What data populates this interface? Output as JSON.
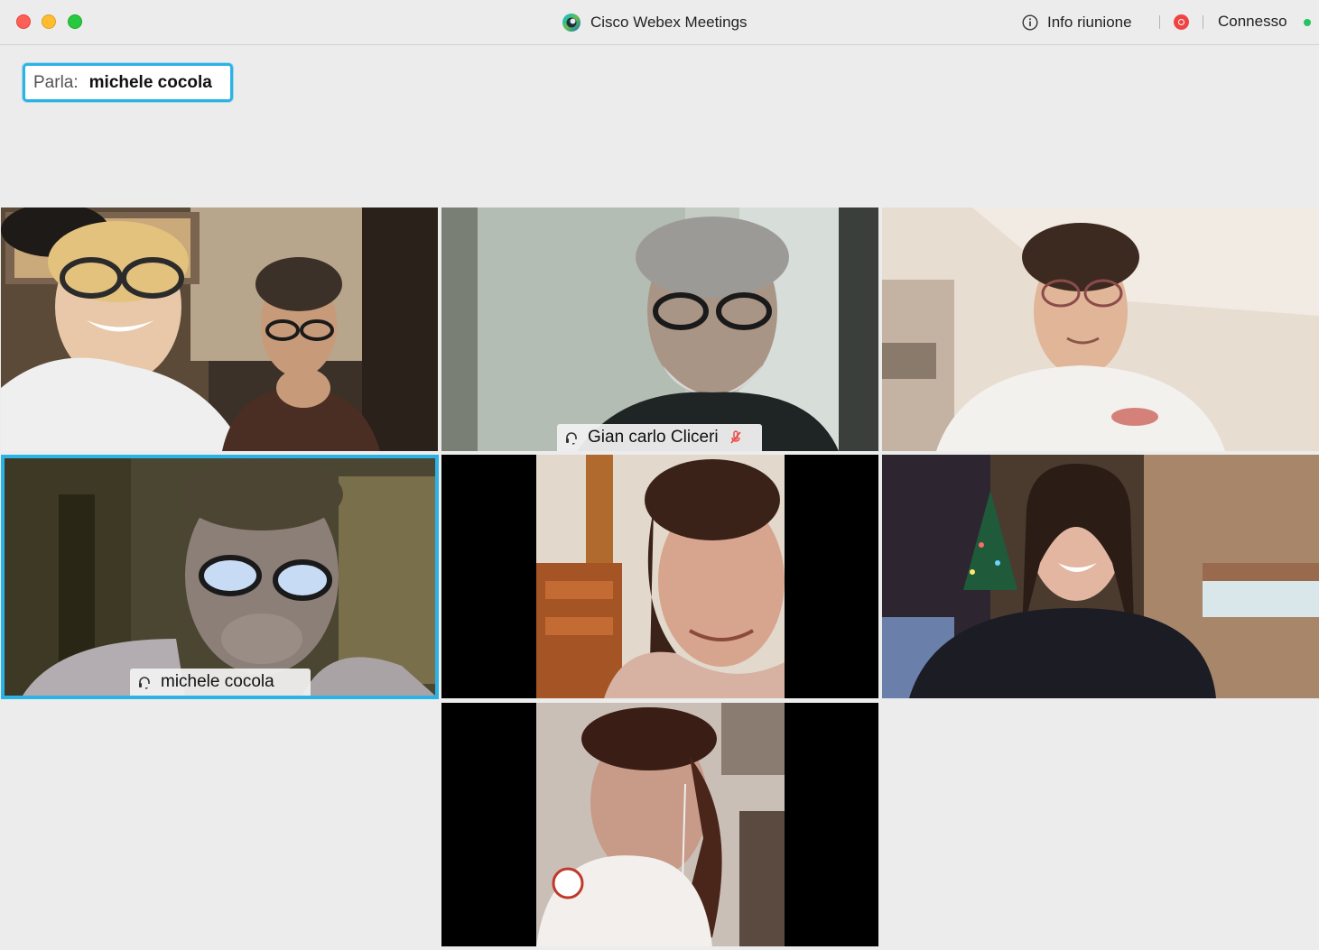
{
  "window": {
    "title": "Cisco Webex Meetings"
  },
  "toolbar": {
    "info_label": "Info riunione",
    "connection_status": "Connesso",
    "status_color": "#22c55e",
    "record_color": "#ef4444"
  },
  "speaker": {
    "label": "Parla:",
    "name": "michele cocola",
    "highlight_color": "#2bb3e6"
  },
  "participants": [
    {
      "id": "p1",
      "name_tag": "",
      "muted": false,
      "active": false
    },
    {
      "id": "p2",
      "name_tag": "Gian carlo Cliceri",
      "muted": true,
      "active": false
    },
    {
      "id": "p3",
      "name_tag": "",
      "muted": false,
      "active": false
    },
    {
      "id": "p4",
      "name_tag": "michele cocola",
      "muted": false,
      "active": true
    },
    {
      "id": "p5",
      "name_tag": "",
      "muted": false,
      "active": false
    },
    {
      "id": "p6",
      "name_tag": "",
      "muted": false,
      "active": false
    },
    {
      "id": "p7",
      "name_tag": "",
      "muted": false,
      "active": false
    }
  ],
  "icons": {
    "app_logo": "webex-logo-icon",
    "info": "info-circle-icon",
    "record": "record-icon",
    "audio": "headset-icon",
    "mute": "mic-muted-icon"
  }
}
